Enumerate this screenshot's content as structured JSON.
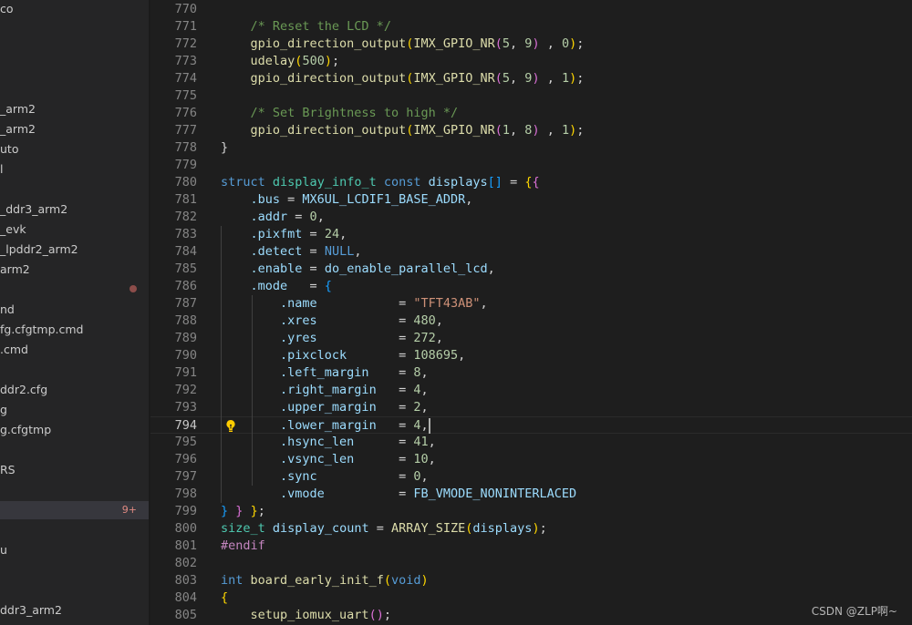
{
  "colors": {
    "keyword": "#569cd6",
    "type": "#4ec9b0",
    "function": "#dcdcaa",
    "variable": "#9cdcfe",
    "number": "#b5cea8",
    "string": "#ce9178",
    "comment": "#6a9955",
    "control": "#c586c0",
    "plain": "#d4d4d4",
    "bracket1": "#ffd700",
    "bracket2": "#da70d6",
    "bracket3": "#179fff"
  },
  "sidebar": {
    "items": [
      {
        "label": "co"
      },
      {
        "label": "_arm2"
      },
      {
        "label": "_arm2"
      },
      {
        "label": "uto"
      },
      {
        "label": "l"
      },
      {
        "label": "_ddr3_arm2"
      },
      {
        "label": "_evk"
      },
      {
        "label": "_lpddr2_arm2"
      },
      {
        "label": "arm2"
      },
      {
        "label": "",
        "dot": true
      },
      {
        "label": "nd"
      },
      {
        "label": "fg.cfgtmp.cmd"
      },
      {
        "label": ".cmd"
      },
      {
        "label": "ddr2.cfg"
      },
      {
        "label": "g"
      },
      {
        "label": "g.cfgtmp"
      },
      {
        "label": "RS"
      },
      {
        "label": "",
        "badge": "9+",
        "selected": true
      },
      {
        "label": "u"
      },
      {
        "label": "ddr3_arm2"
      }
    ]
  },
  "editor": {
    "lines": [
      {
        "n": "770",
        "t": [
          [
            "",
            "plain"
          ]
        ]
      },
      {
        "n": "771",
        "t": [
          [
            "    ",
            "plain"
          ],
          [
            "/* Reset the LCD */",
            "comment"
          ]
        ]
      },
      {
        "n": "772",
        "t": [
          [
            "    ",
            "plain"
          ],
          [
            "gpio_direction_output",
            "function"
          ],
          [
            "(",
            "bracket1"
          ],
          [
            "IMX_GPIO_NR",
            "function"
          ],
          [
            "(",
            "bracket2"
          ],
          [
            "5",
            "number"
          ],
          [
            ", ",
            "plain"
          ],
          [
            "9",
            "number"
          ],
          [
            ")",
            "bracket2"
          ],
          [
            " , ",
            "plain"
          ],
          [
            "0",
            "number"
          ],
          [
            ")",
            "bracket1"
          ],
          [
            ";",
            "plain"
          ]
        ]
      },
      {
        "n": "773",
        "t": [
          [
            "    ",
            "plain"
          ],
          [
            "udelay",
            "function"
          ],
          [
            "(",
            "bracket1"
          ],
          [
            "500",
            "number"
          ],
          [
            ")",
            "bracket1"
          ],
          [
            ";",
            "plain"
          ]
        ]
      },
      {
        "n": "774",
        "t": [
          [
            "    ",
            "plain"
          ],
          [
            "gpio_direction_output",
            "function"
          ],
          [
            "(",
            "bracket1"
          ],
          [
            "IMX_GPIO_NR",
            "function"
          ],
          [
            "(",
            "bracket2"
          ],
          [
            "5",
            "number"
          ],
          [
            ", ",
            "plain"
          ],
          [
            "9",
            "number"
          ],
          [
            ")",
            "bracket2"
          ],
          [
            " , ",
            "plain"
          ],
          [
            "1",
            "number"
          ],
          [
            ")",
            "bracket1"
          ],
          [
            ";",
            "plain"
          ]
        ]
      },
      {
        "n": "775",
        "t": [
          [
            "",
            "plain"
          ]
        ]
      },
      {
        "n": "776",
        "t": [
          [
            "    ",
            "plain"
          ],
          [
            "/* Set Brightness to high */",
            "comment"
          ]
        ]
      },
      {
        "n": "777",
        "t": [
          [
            "    ",
            "plain"
          ],
          [
            "gpio_direction_output",
            "function"
          ],
          [
            "(",
            "bracket1"
          ],
          [
            "IMX_GPIO_NR",
            "function"
          ],
          [
            "(",
            "bracket2"
          ],
          [
            "1",
            "number"
          ],
          [
            ", ",
            "plain"
          ],
          [
            "8",
            "number"
          ],
          [
            ")",
            "bracket2"
          ],
          [
            " , ",
            "plain"
          ],
          [
            "1",
            "number"
          ],
          [
            ")",
            "bracket1"
          ],
          [
            ";",
            "plain"
          ]
        ]
      },
      {
        "n": "778",
        "t": [
          [
            "}",
            "plain"
          ]
        ]
      },
      {
        "n": "779",
        "t": [
          [
            "",
            "plain"
          ]
        ]
      },
      {
        "n": "780",
        "t": [
          [
            "struct",
            "keyword"
          ],
          [
            " ",
            "plain"
          ],
          [
            "display_info_t",
            "type"
          ],
          [
            " ",
            "plain"
          ],
          [
            "const",
            "keyword"
          ],
          [
            " ",
            "plain"
          ],
          [
            "displays",
            "variable"
          ],
          [
            "[]",
            "bracket3"
          ],
          [
            " = ",
            "plain"
          ],
          [
            "{",
            "bracket1"
          ],
          [
            "{",
            "bracket2"
          ]
        ]
      },
      {
        "n": "781",
        "t": [
          [
            "    ",
            "plain"
          ],
          [
            ".bus",
            "variable"
          ],
          [
            " = ",
            "plain"
          ],
          [
            "MX6UL_LCDIF1_BASE_ADDR",
            "variable"
          ],
          [
            ",",
            "plain"
          ]
        ]
      },
      {
        "n": "782",
        "t": [
          [
            "    ",
            "plain"
          ],
          [
            ".addr",
            "variable"
          ],
          [
            " = ",
            "plain"
          ],
          [
            "0",
            "number"
          ],
          [
            ",",
            "plain"
          ]
        ]
      },
      {
        "n": "783",
        "t": [
          [
            "    ",
            "plain"
          ],
          [
            ".pixfmt",
            "variable"
          ],
          [
            " = ",
            "plain"
          ],
          [
            "24",
            "number"
          ],
          [
            ",",
            "plain"
          ]
        ]
      },
      {
        "n": "784",
        "t": [
          [
            "    ",
            "plain"
          ],
          [
            ".detect",
            "variable"
          ],
          [
            " = ",
            "plain"
          ],
          [
            "NULL",
            "keyword"
          ],
          [
            ",",
            "plain"
          ]
        ]
      },
      {
        "n": "785",
        "t": [
          [
            "    ",
            "plain"
          ],
          [
            ".enable",
            "variable"
          ],
          [
            " = ",
            "plain"
          ],
          [
            "do_enable_parallel_lcd",
            "variable"
          ],
          [
            ",",
            "plain"
          ]
        ]
      },
      {
        "n": "786",
        "t": [
          [
            "    ",
            "plain"
          ],
          [
            ".mode",
            "variable"
          ],
          [
            "   = ",
            "plain"
          ],
          [
            "{",
            "bracket3"
          ]
        ]
      },
      {
        "n": "787",
        "t": [
          [
            "        ",
            "plain"
          ],
          [
            ".name",
            "variable"
          ],
          [
            "           = ",
            "plain"
          ],
          [
            "\"TFT43AB\"",
            "string"
          ],
          [
            ",",
            "plain"
          ]
        ]
      },
      {
        "n": "788",
        "t": [
          [
            "        ",
            "plain"
          ],
          [
            ".xres",
            "variable"
          ],
          [
            "           = ",
            "plain"
          ],
          [
            "480",
            "number"
          ],
          [
            ",",
            "plain"
          ]
        ]
      },
      {
        "n": "789",
        "t": [
          [
            "        ",
            "plain"
          ],
          [
            ".yres",
            "variable"
          ],
          [
            "           = ",
            "plain"
          ],
          [
            "272",
            "number"
          ],
          [
            ",",
            "plain"
          ]
        ]
      },
      {
        "n": "790",
        "t": [
          [
            "        ",
            "plain"
          ],
          [
            ".pixclock",
            "variable"
          ],
          [
            "       = ",
            "plain"
          ],
          [
            "108695",
            "number"
          ],
          [
            ",",
            "plain"
          ]
        ]
      },
      {
        "n": "791",
        "t": [
          [
            "        ",
            "plain"
          ],
          [
            ".left_margin",
            "variable"
          ],
          [
            "    = ",
            "plain"
          ],
          [
            "8",
            "number"
          ],
          [
            ",",
            "plain"
          ]
        ]
      },
      {
        "n": "792",
        "t": [
          [
            "        ",
            "plain"
          ],
          [
            ".right_margin",
            "variable"
          ],
          [
            "   = ",
            "plain"
          ],
          [
            "4",
            "number"
          ],
          [
            ",",
            "plain"
          ]
        ]
      },
      {
        "n": "793",
        "t": [
          [
            "        ",
            "plain"
          ],
          [
            ".upper_margin",
            "variable"
          ],
          [
            "   = ",
            "plain"
          ],
          [
            "2",
            "number"
          ],
          [
            ",",
            "plain"
          ]
        ]
      },
      {
        "n": "794",
        "t": [
          [
            "        ",
            "plain"
          ],
          [
            ".lower_margin",
            "variable"
          ],
          [
            "   = ",
            "plain"
          ],
          [
            "4",
            "number"
          ],
          [
            ",",
            "plain"
          ]
        ],
        "current": true,
        "bulb": true
      },
      {
        "n": "795",
        "t": [
          [
            "        ",
            "plain"
          ],
          [
            ".hsync_len",
            "variable"
          ],
          [
            "      = ",
            "plain"
          ],
          [
            "41",
            "number"
          ],
          [
            ",",
            "plain"
          ]
        ]
      },
      {
        "n": "796",
        "t": [
          [
            "        ",
            "plain"
          ],
          [
            ".vsync_len",
            "variable"
          ],
          [
            "      = ",
            "plain"
          ],
          [
            "10",
            "number"
          ],
          [
            ",",
            "plain"
          ]
        ]
      },
      {
        "n": "797",
        "t": [
          [
            "        ",
            "plain"
          ],
          [
            ".sync",
            "variable"
          ],
          [
            "           = ",
            "plain"
          ],
          [
            "0",
            "number"
          ],
          [
            ",",
            "plain"
          ]
        ]
      },
      {
        "n": "798",
        "t": [
          [
            "        ",
            "plain"
          ],
          [
            ".vmode",
            "variable"
          ],
          [
            "          = ",
            "plain"
          ],
          [
            "FB_VMODE_NONINTERLACED",
            "variable"
          ]
        ]
      },
      {
        "n": "799",
        "t": [
          [
            "}",
            "bracket3"
          ],
          [
            " ",
            "plain"
          ],
          [
            "}",
            "bracket2"
          ],
          [
            " ",
            "plain"
          ],
          [
            "}",
            "bracket1"
          ],
          [
            ";",
            "plain"
          ]
        ]
      },
      {
        "n": "800",
        "t": [
          [
            "size_t",
            "type"
          ],
          [
            " ",
            "plain"
          ],
          [
            "display_count",
            "variable"
          ],
          [
            " = ",
            "plain"
          ],
          [
            "ARRAY_SIZE",
            "function"
          ],
          [
            "(",
            "bracket1"
          ],
          [
            "displays",
            "variable"
          ],
          [
            ")",
            "bracket1"
          ],
          [
            ";",
            "plain"
          ]
        ]
      },
      {
        "n": "801",
        "t": [
          [
            "#endif",
            "control"
          ]
        ]
      },
      {
        "n": "802",
        "t": [
          [
            "",
            "plain"
          ]
        ]
      },
      {
        "n": "803",
        "t": [
          [
            "int",
            "keyword"
          ],
          [
            " ",
            "plain"
          ],
          [
            "board_early_init_f",
            "function"
          ],
          [
            "(",
            "bracket1"
          ],
          [
            "void",
            "keyword"
          ],
          [
            ")",
            "bracket1"
          ]
        ]
      },
      {
        "n": "804",
        "t": [
          [
            "{",
            "bracket1"
          ]
        ]
      },
      {
        "n": "805",
        "t": [
          [
            "    ",
            "plain"
          ],
          [
            "setup_iomux_uart",
            "function"
          ],
          [
            "(",
            "bracket2"
          ],
          [
            ")",
            "bracket2"
          ],
          [
            ";",
            "plain"
          ]
        ]
      }
    ]
  },
  "watermark": "CSDN @ZLP啊~"
}
